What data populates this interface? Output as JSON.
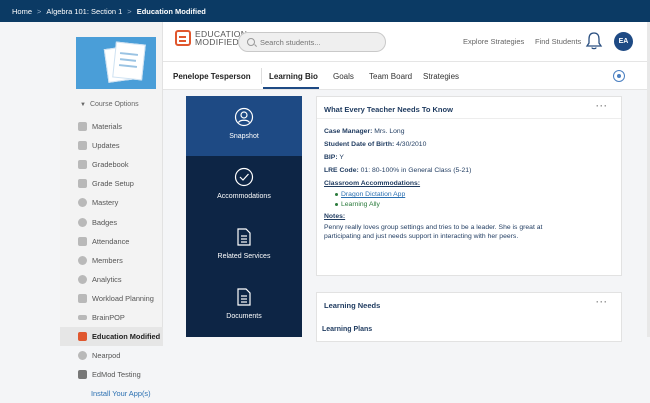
{
  "breadcrumb": [
    "Home",
    "Algebra 101: Section 1",
    "Education Modified"
  ],
  "breadcrumb_sep": ">",
  "sidebar": {
    "course_options": "Course Options",
    "items": [
      {
        "label": "Materials",
        "icon": "materials-icon"
      },
      {
        "label": "Updates",
        "icon": "updates-icon"
      },
      {
        "label": "Gradebook",
        "icon": "gradebook-icon"
      },
      {
        "label": "Grade Setup",
        "icon": "grade-setup-icon"
      },
      {
        "label": "Mastery",
        "icon": "mastery-icon"
      },
      {
        "label": "Badges",
        "icon": "badges-icon"
      },
      {
        "label": "Attendance",
        "icon": "attendance-icon"
      },
      {
        "label": "Members",
        "icon": "members-icon"
      },
      {
        "label": "Analytics",
        "icon": "analytics-icon"
      },
      {
        "label": "Workload Planning",
        "icon": "workload-icon"
      },
      {
        "label": "BrainPOP",
        "icon": "brainpop-icon"
      },
      {
        "label": "Education Modified",
        "icon": "education-modified-icon",
        "active": true
      },
      {
        "label": "Nearpod",
        "icon": "nearpod-icon"
      },
      {
        "label": "EdMod Testing",
        "icon": "edmod-icon"
      }
    ],
    "install_link": "Install Your App(s)"
  },
  "header": {
    "logo_line1": "EDUCATION",
    "logo_line2": "MODIFIED",
    "search_placeholder": "Search students...",
    "explore": "Explore Strategies",
    "find_students": "Find Students",
    "avatar_initials": "EA"
  },
  "tabs": {
    "student_name": "Penelope Tesperson",
    "items": [
      "Learning Bio",
      "Goals",
      "Team Board",
      "Strategies"
    ],
    "active": "Learning Bio"
  },
  "menu": [
    "Snapshot",
    "Accommodations",
    "Related Services",
    "Documents"
  ],
  "card1": {
    "title": "What Every Teacher Needs To Know",
    "case_manager_label": "Case Manager:",
    "case_manager": "Mrs. Long",
    "dob_label": "Student Date of Birth:",
    "dob": "4/30/2010",
    "bip_label": "BIP:",
    "bip": "Y",
    "lre_label": "LRE Code:",
    "lre": "01: 80-100% in General Class (5-21)",
    "accommodations_label": "Classroom Accommodations:",
    "accommodations": [
      "Dragon Dictation App",
      "Learning Ally"
    ],
    "notes_label": "Notes:",
    "notes": "Penny really loves group settings and tries to be a leader. She is great at participating and just needs support in interacting with her peers."
  },
  "card2": {
    "title": "Learning Needs",
    "sub": "Learning Plans"
  },
  "dots": "···",
  "colors": {
    "topbar": "#0b3a64",
    "menu": "#0d2545",
    "menu_active": "#1e4a84",
    "accent": "#e0572e"
  }
}
